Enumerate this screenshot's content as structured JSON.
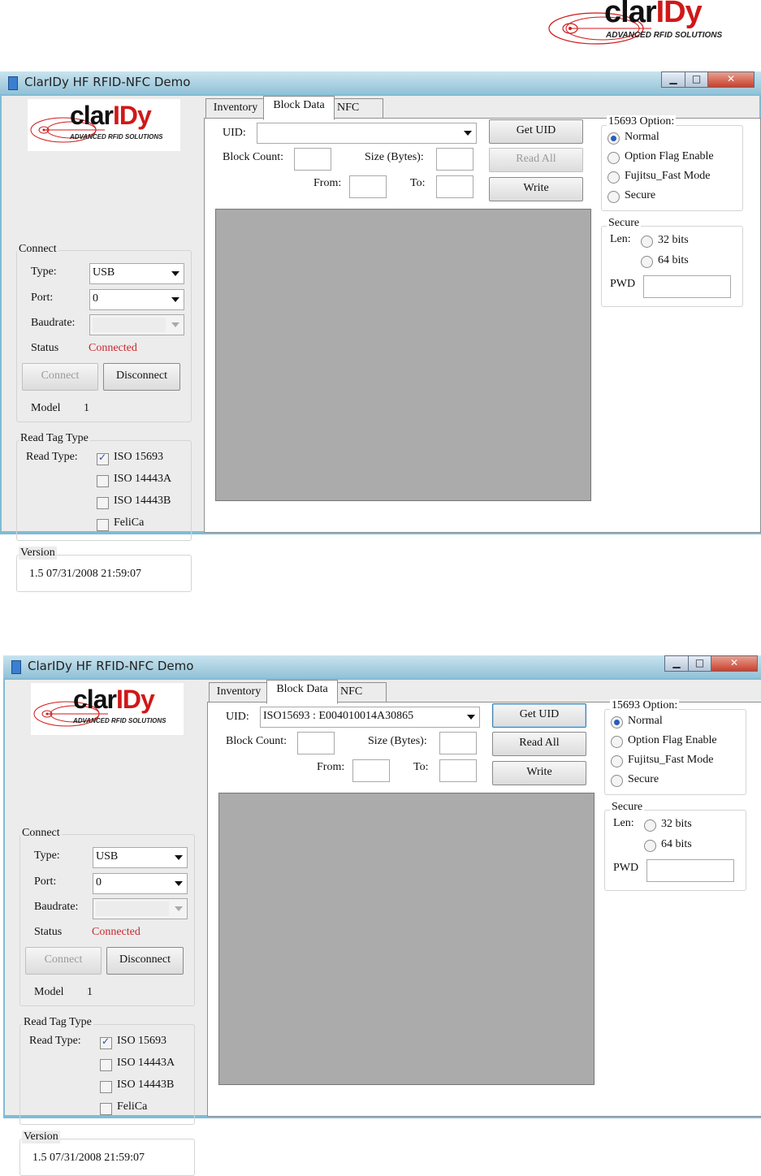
{
  "brand": {
    "wordmark_clar": "clar",
    "wordmark_idy": "IDy",
    "tagline": "ADVANCED RFID SOLUTIONS",
    "accent_color": "#d01818"
  },
  "windows": [
    {
      "title": "ClarIDy HF RFID-NFC Demo",
      "title_icon": "app-icon",
      "controls": {
        "minimize": "▁",
        "maximize": "□",
        "close": "✕"
      },
      "connect": {
        "group_label": "Connect",
        "type_label": "Type:",
        "type_value": "USB",
        "port_label": "Port:",
        "port_value": "0",
        "baudrate_label": "Baudrate:",
        "baudrate_value": "",
        "status_label": "Status",
        "status_value": "Connected",
        "connect_button": "Connect",
        "disconnect_button": "Disconnect",
        "model_label": "Model",
        "model_value": "1"
      },
      "read_tag_type": {
        "group_label": "Read Tag Type",
        "read_type_label": "Read Type:",
        "options": [
          {
            "label": "ISO 15693",
            "checked": true
          },
          {
            "label": "ISO 14443A",
            "checked": false
          },
          {
            "label": "ISO 14443B",
            "checked": false
          },
          {
            "label": "FeliCa",
            "checked": false
          }
        ]
      },
      "version": {
        "group_label": "Version",
        "value": "1.5 07/31/2008 21:59:07"
      },
      "tabs": [
        "Inventory",
        "Block Data",
        "NFC"
      ],
      "active_tab": "Block Data",
      "block_data": {
        "uid_label": "UID:",
        "uid_value": "",
        "block_count_label": "Block Count:",
        "block_count_value": "",
        "size_label": "Size (Bytes):",
        "size_value": "",
        "from_label": "From:",
        "from_value": "",
        "to_label": "To:",
        "to_value": "",
        "get_uid_button": "Get UID",
        "read_all_button": "Read All",
        "write_button": "Write",
        "read_all_enabled": false
      },
      "option_15693": {
        "group_label": "15693 Option:",
        "options": [
          {
            "label": "Normal",
            "selected": true
          },
          {
            "label": "Option Flag Enable",
            "selected": false
          },
          {
            "label": "Fujitsu_Fast Mode",
            "selected": false
          },
          {
            "label": "Secure",
            "selected": false
          }
        ]
      },
      "secure": {
        "group_label": "Secure",
        "len_label": "Len:",
        "len_options": [
          {
            "label": "32 bits",
            "selected": false
          },
          {
            "label": "64 bits",
            "selected": false
          }
        ],
        "pwd_label": "PWD",
        "pwd_value": ""
      }
    },
    {
      "title": "ClarIDy HF RFID-NFC Demo",
      "title_icon": "app-icon",
      "controls": {
        "minimize": "▁",
        "maximize": "□",
        "close": "✕"
      },
      "connect": {
        "group_label": "Connect",
        "type_label": "Type:",
        "type_value": "USB",
        "port_label": "Port:",
        "port_value": "0",
        "baudrate_label": "Baudrate:",
        "baudrate_value": "",
        "status_label": "Status",
        "status_value": "Connected",
        "connect_button": "Connect",
        "disconnect_button": "Disconnect",
        "model_label": "Model",
        "model_value": "1"
      },
      "read_tag_type": {
        "group_label": "Read Tag Type",
        "read_type_label": "Read Type:",
        "options": [
          {
            "label": "ISO 15693",
            "checked": true
          },
          {
            "label": "ISO 14443A",
            "checked": false
          },
          {
            "label": "ISO 14443B",
            "checked": false
          },
          {
            "label": "FeliCa",
            "checked": false
          }
        ]
      },
      "version": {
        "group_label": "Version",
        "value": "1.5 07/31/2008 21:59:07"
      },
      "tabs": [
        "Inventory",
        "Block Data",
        "NFC"
      ],
      "active_tab": "Block Data",
      "block_data": {
        "uid_label": "UID:",
        "uid_value": "ISO15693 : E004010014A30865",
        "block_count_label": "Block Count:",
        "block_count_value": "",
        "size_label": "Size (Bytes):",
        "size_value": "",
        "from_label": "From:",
        "from_value": "",
        "to_label": "To:",
        "to_value": "",
        "get_uid_button": "Get UID",
        "read_all_button": "Read All",
        "write_button": "Write",
        "read_all_enabled": true
      },
      "option_15693": {
        "group_label": "15693 Option:",
        "options": [
          {
            "label": "Normal",
            "selected": true
          },
          {
            "label": "Option Flag Enable",
            "selected": false
          },
          {
            "label": "Fujitsu_Fast Mode",
            "selected": false
          },
          {
            "label": "Secure",
            "selected": false
          }
        ]
      },
      "secure": {
        "group_label": "Secure",
        "len_label": "Len:",
        "len_options": [
          {
            "label": "32 bits",
            "selected": false
          },
          {
            "label": "64 bits",
            "selected": false
          }
        ],
        "pwd_label": "PWD",
        "pwd_value": ""
      }
    }
  ]
}
